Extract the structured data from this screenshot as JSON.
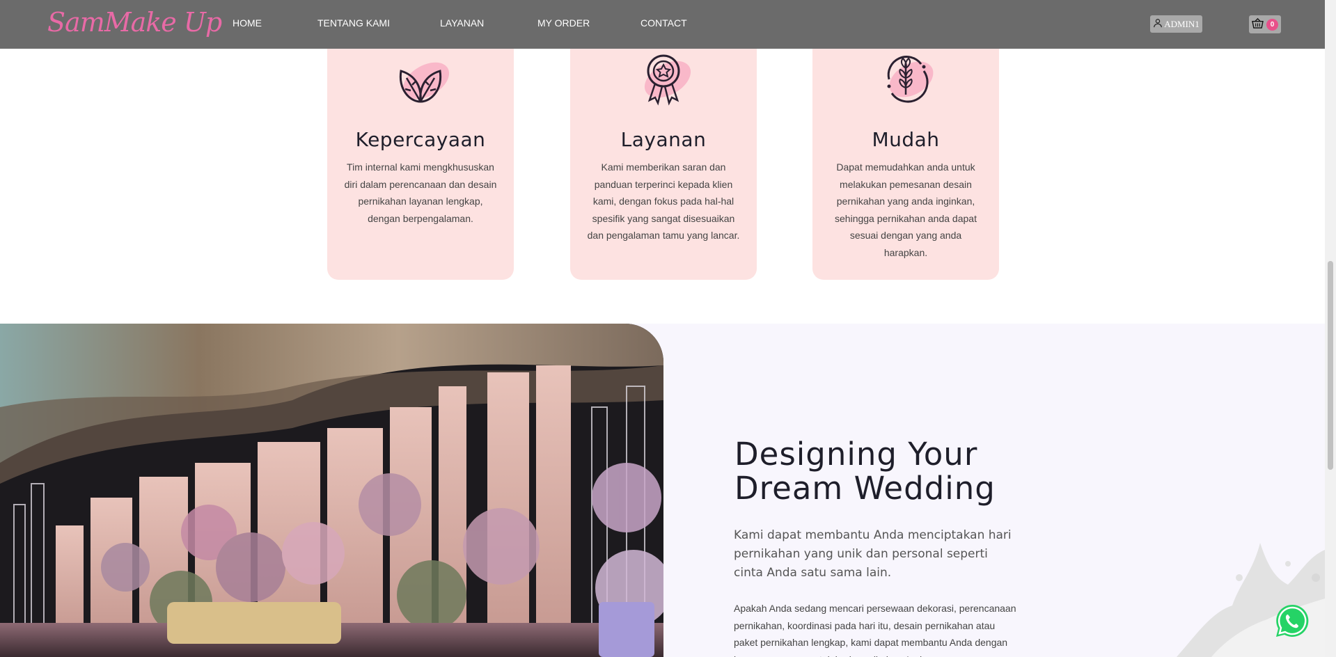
{
  "navbar": {
    "brand": "SamMake Up",
    "items": [
      "HOME",
      "TENTANG KAMI",
      "LAYANAN",
      "MY ORDER",
      "CONTACT"
    ],
    "admin_label": "ADMIN1",
    "cart_count": "0",
    "icons": {
      "admin": "user-icon",
      "cart": "basket-icon"
    }
  },
  "features": [
    {
      "title": "Kepercayaan",
      "description": "Tim internal kami mengkhususkan diri dalam perencanaan dan desain pernikahan layanan lengkap, dengan berpengalaman.",
      "icon": "leaf-icon"
    },
    {
      "title": "Layanan",
      "description": "Kami memberikan saran dan panduan terperinci kepada klien kami, dengan fokus pada hal-hal spesifik yang sangat disesuaikan dan pengalaman tamu yang lancar.",
      "icon": "award-badge-icon"
    },
    {
      "title": "Mudah",
      "description": "Dapat memudahkan anda untuk melakukan pemesanan desain pernikahan yang anda inginkan, sehingga pernikahan anda dapat sesuai dengan yang anda harapkan.",
      "icon": "wheat-icon"
    }
  ],
  "about": {
    "headline_line1": "Designing Your",
    "headline_line2": "Dream Wedding",
    "lead": "Kami dapat membantu Anda menciptakan hari pernikahan yang unik dan personal seperti cinta Anda satu sama lain.",
    "body": "Apakah Anda sedang mencari persewaan dekorasi, perencanaan pernikahan, koordinasi pada hari itu, desain pernikahan atau paket pernikahan lengkap, kami dapat membantu Anda dengan layanan apa pun untuk hari pernikahan Anda."
  },
  "colors": {
    "navbar": "#6b6b6b",
    "brand": "#e86aa6",
    "card": "#fde2e1",
    "badge": "#e8508a",
    "whatsapp": "#25d366"
  },
  "floating": {
    "icon": "whatsapp-icon"
  }
}
